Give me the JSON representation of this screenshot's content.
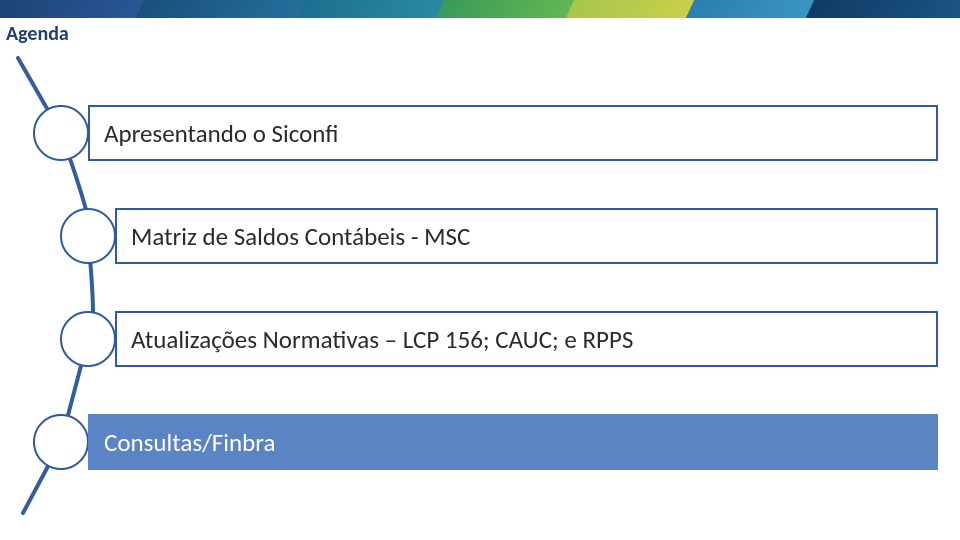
{
  "title": "Agenda",
  "items": [
    {
      "label": "Apresentando o Siconfi",
      "active": false
    },
    {
      "label": "Matriz de Saldos Contábeis - MSC",
      "active": false
    },
    {
      "label": "Atualizações Normativas – LCP 156; CAUC; e RPPS",
      "active": false
    },
    {
      "label": "Consultas/Finbra",
      "active": true
    }
  ]
}
